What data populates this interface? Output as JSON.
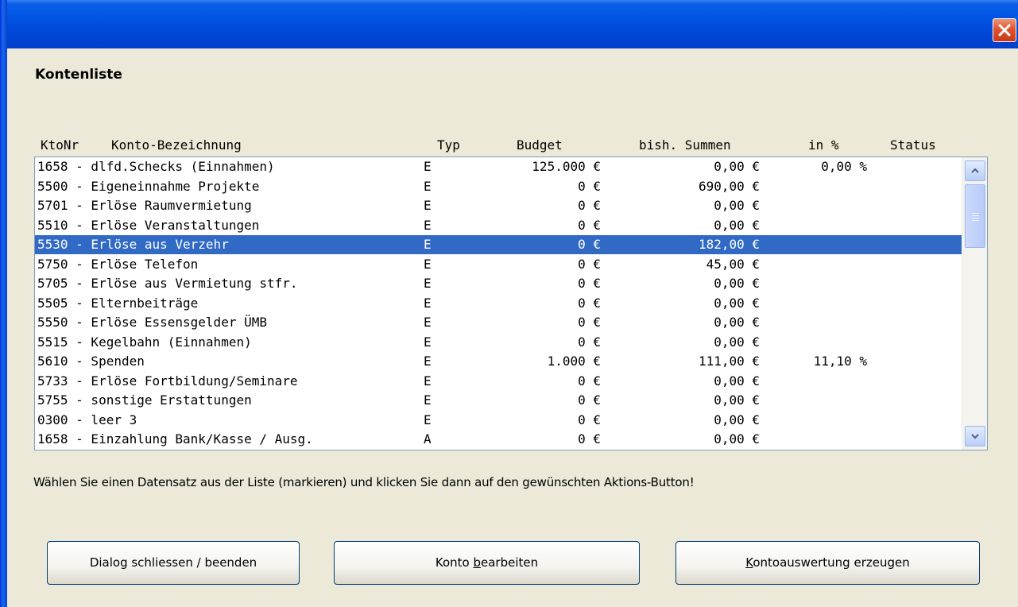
{
  "window": {
    "close_glyph": "×"
  },
  "heading": "Kontenliste",
  "columns": {
    "ktonr": "KtoNr",
    "bezeichnung": "Konto-Bezeichnung",
    "typ": "Typ",
    "budget": "Budget",
    "summen": "bish. Summen",
    "pct": "in %",
    "status": "Status"
  },
  "rows": [
    {
      "nr": "1658 - dlfd.Schecks (Einnahmen)",
      "typ": "E",
      "budget": "125.000 €",
      "summen": "0,00 €",
      "pct": "0,00 %"
    },
    {
      "nr": "5500 - Eigeneinnahme Projekte",
      "typ": "E",
      "budget": "0 €",
      "summen": "690,00 €",
      "pct": ""
    },
    {
      "nr": "5701 - Erlöse Raumvermietung",
      "typ": "E",
      "budget": "0 €",
      "summen": "0,00 €",
      "pct": ""
    },
    {
      "nr": "5510 - Erlöse Veranstaltungen",
      "typ": "E",
      "budget": "0 €",
      "summen": "0,00 €",
      "pct": ""
    },
    {
      "nr": "5530 - Erlöse aus Verzehr",
      "typ": "E",
      "budget": "0 €",
      "summen": "182,00 €",
      "pct": "",
      "selected": true
    },
    {
      "nr": "5750 - Erlöse Telefon",
      "typ": "E",
      "budget": "0 €",
      "summen": "45,00 €",
      "pct": ""
    },
    {
      "nr": "5705 - Erlöse aus Vermietung stfr.",
      "typ": "E",
      "budget": "0 €",
      "summen": "0,00 €",
      "pct": ""
    },
    {
      "nr": "5505 - Elternbeiträge",
      "typ": "E",
      "budget": "0 €",
      "summen": "0,00 €",
      "pct": ""
    },
    {
      "nr": "5550 - Erlöse Essensgelder ÜMB",
      "typ": "E",
      "budget": "0 €",
      "summen": "0,00 €",
      "pct": ""
    },
    {
      "nr": "5515 - Kegelbahn (Einnahmen)",
      "typ": "E",
      "budget": "0 €",
      "summen": "0,00 €",
      "pct": ""
    },
    {
      "nr": "5610 - Spenden",
      "typ": "E",
      "budget": "1.000 €",
      "summen": "111,00 €",
      "pct": "11,10 %"
    },
    {
      "nr": "5733 - Erlöse Fortbildung/Seminare",
      "typ": "E",
      "budget": "0 €",
      "summen": "0,00 €",
      "pct": ""
    },
    {
      "nr": "5755 - sonstige Erstattungen",
      "typ": "E",
      "budget": "0 €",
      "summen": "0,00 €",
      "pct": ""
    },
    {
      "nr": "0300 - leer 3",
      "typ": "E",
      "budget": "0 €",
      "summen": "0,00 €",
      "pct": ""
    },
    {
      "nr": "1658 - Einzahlung Bank/Kasse / Ausg.",
      "typ": "A",
      "budget": "0 €",
      "summen": "0,00 €",
      "pct": ""
    }
  ],
  "hint": "Wählen Sie einen Datensatz aus der Liste (markieren) und klicken Sie dann auf den gewünschten Aktions-Button!",
  "buttons": {
    "close": "Dialog schliessen / beenden",
    "edit_pre": "Konto ",
    "edit_u": "b",
    "edit_post": "earbeiten",
    "report_u": "K",
    "report_post": "ontoauswertung erzeugen"
  },
  "colors": {
    "selection": "#316ac5",
    "titlebar": "#0055e5",
    "dialog_bg": "#ece9d8"
  }
}
